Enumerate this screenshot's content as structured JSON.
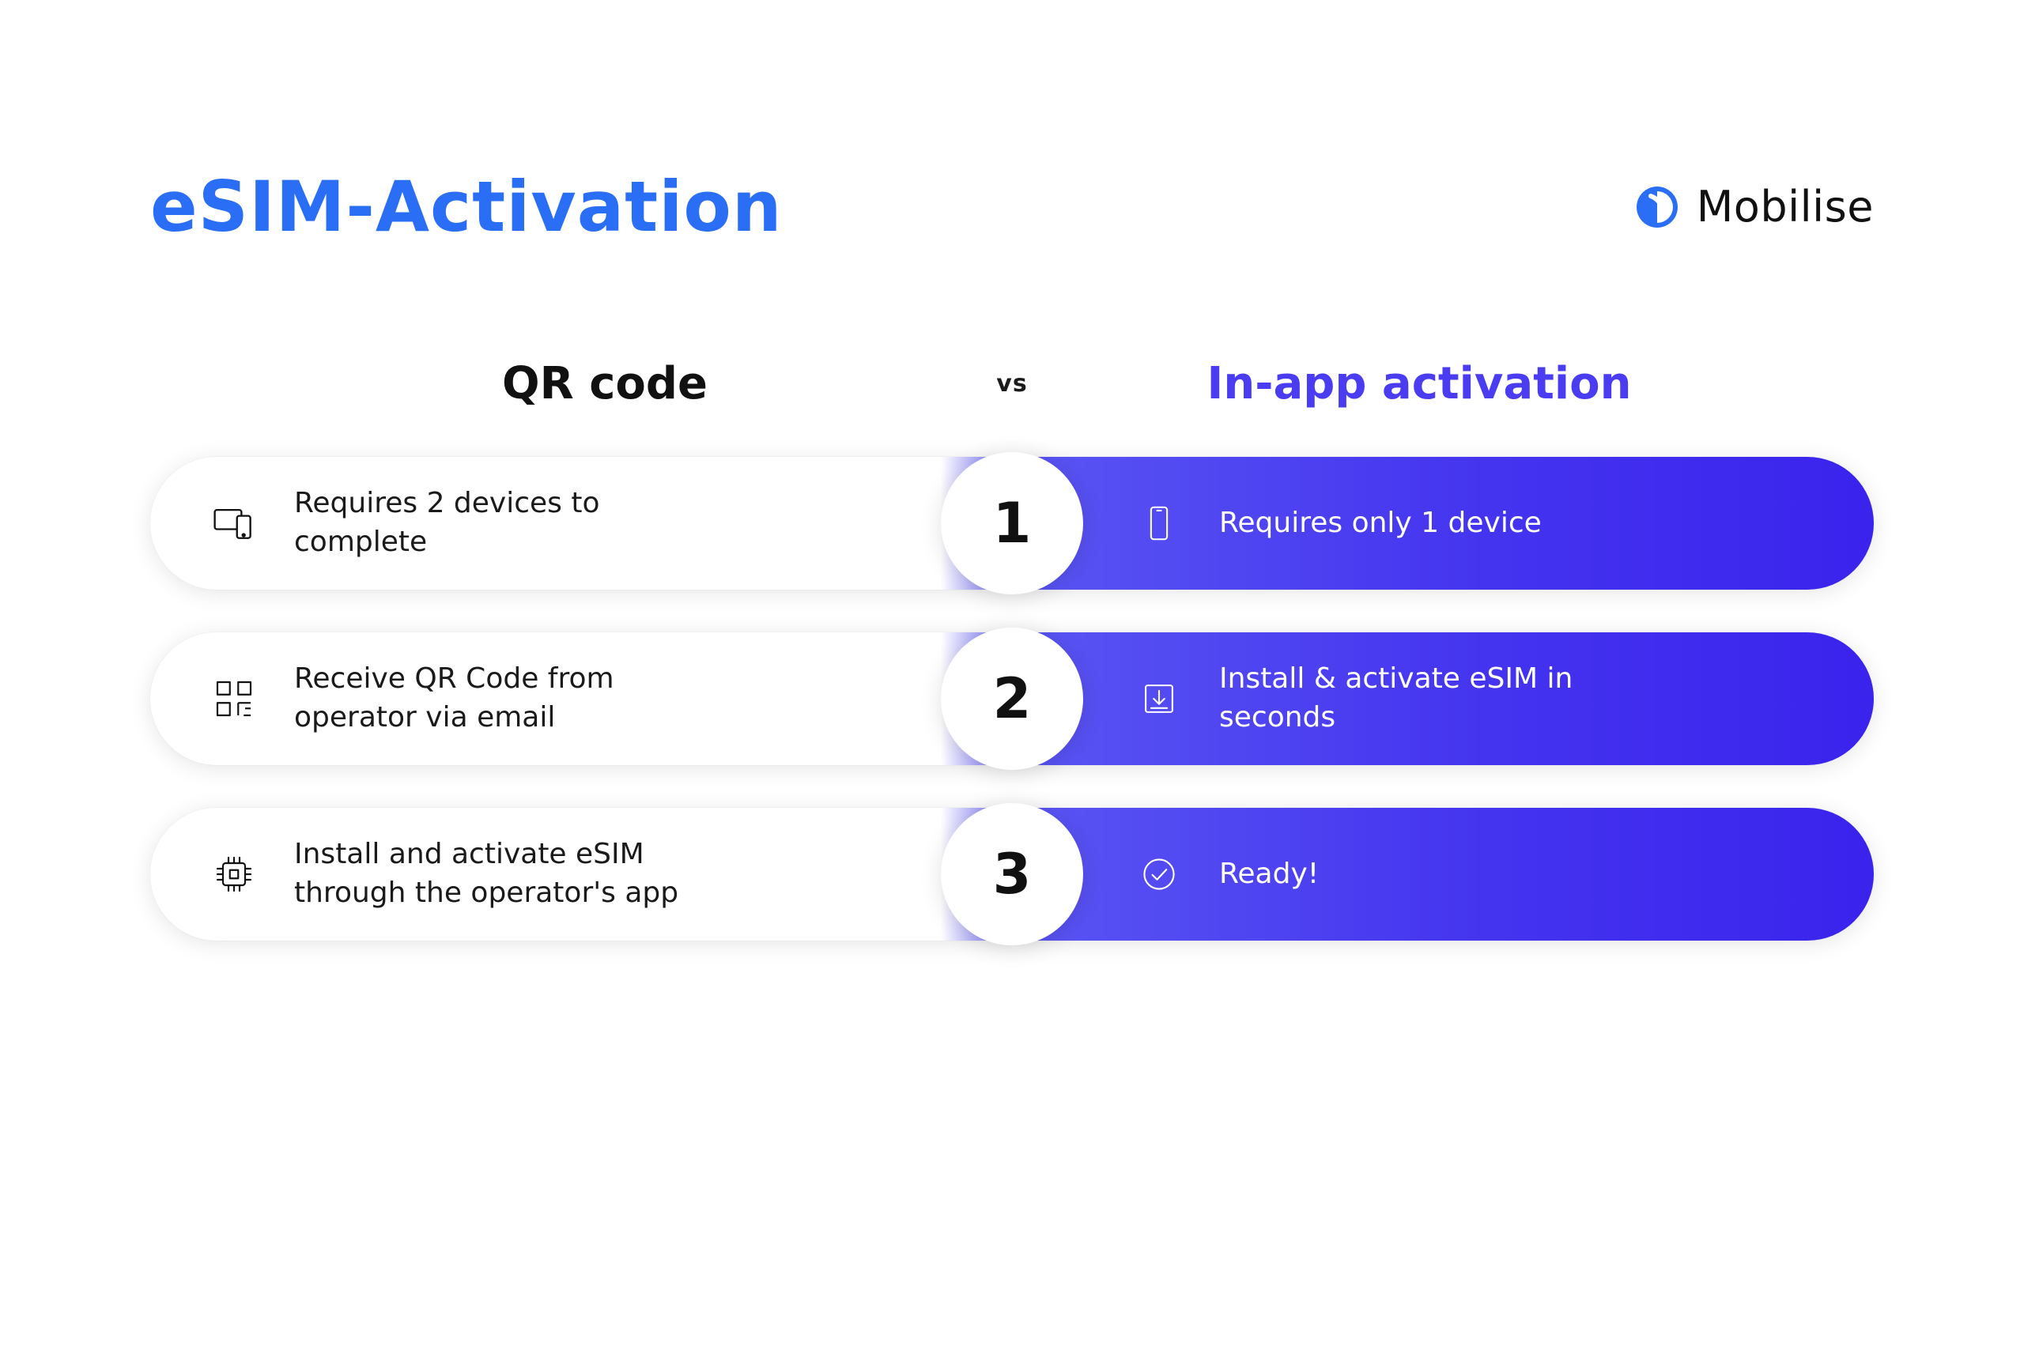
{
  "header": {
    "title": "eSIM-Activation",
    "brand_name": "Mobilise"
  },
  "columns": {
    "left_heading": "QR code",
    "separator": "vs",
    "right_heading": "In-app activation"
  },
  "rows": [
    {
      "number": "1",
      "left_icon": "devices-icon",
      "left_text": "Requires 2 devices to complete",
      "right_icon": "phone-icon",
      "right_text": "Requires only 1 device"
    },
    {
      "number": "2",
      "left_icon": "qr-icon",
      "left_text": "Receive QR Code from operator via email",
      "right_icon": "download-icon",
      "right_text": "Install & activate eSIM in seconds"
    },
    {
      "number": "3",
      "left_icon": "chip-icon",
      "left_text": "Install and activate eSIM through the operator's app",
      "right_icon": "check-circle-icon",
      "right_text": "Ready!"
    }
  ]
}
